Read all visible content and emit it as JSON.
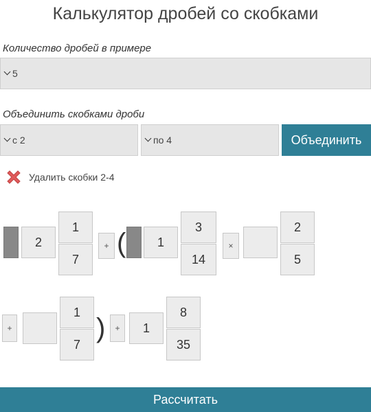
{
  "title": "Калькулятор дробей со скобками",
  "fractions_count": {
    "label": "Количество дробей в примере",
    "value": "5"
  },
  "merge": {
    "label": "Объединить скобками дроби",
    "from_value": "с 2",
    "to_value": "по 4",
    "button_label": "Объединить"
  },
  "remove_brackets_label": "Удалить скобки 2-4",
  "row1": {
    "f1": {
      "whole": "2",
      "num": "1",
      "den": "7"
    },
    "op1": "+",
    "open_paren": "(",
    "f2": {
      "whole": "1",
      "num": "3",
      "den": "14"
    },
    "op2": "×",
    "f3": {
      "whole": "",
      "num": "2",
      "den": "5"
    }
  },
  "row2": {
    "op3": "+",
    "f4": {
      "whole": "",
      "num": "1",
      "den": "7"
    },
    "close_paren": ")",
    "op4": "+",
    "f5": {
      "whole": "1",
      "num": "8",
      "den": "35"
    }
  },
  "calculate_label": "Рассчитать",
  "colors": {
    "accent": "#2f7f96",
    "field": "#e6e6e6",
    "dark_handle": "#888888",
    "delete": "#e05a5a"
  }
}
